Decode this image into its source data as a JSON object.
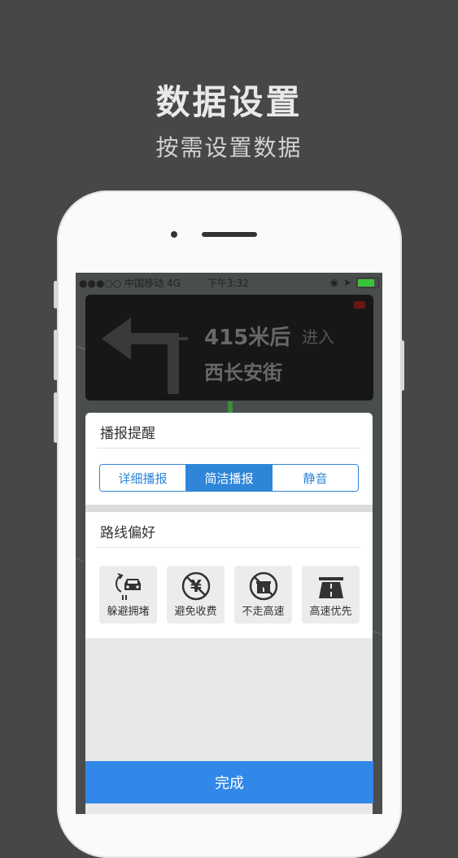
{
  "promo": {
    "title": "数据设置",
    "subtitle": "按需设置数据"
  },
  "statusbar": {
    "carrier": "●●●○○ 中国移动  4G",
    "time": "下午3:32",
    "battery_color": "#39c339"
  },
  "nav": {
    "distance": "415米后",
    "action": "进入",
    "street": "西长安街",
    "turn_icon": "turn-left-arrow"
  },
  "broadcast": {
    "title": "播报提醒",
    "options": [
      "详细播报",
      "简洁播报",
      "静音"
    ],
    "selected": "简洁播报"
  },
  "route": {
    "title": "路线偏好",
    "options": [
      {
        "label": "躲避拥堵",
        "icon": "avoid-congestion-icon"
      },
      {
        "label": "避免收费",
        "icon": "no-toll-icon"
      },
      {
        "label": "不走高速",
        "icon": "no-highway-icon"
      },
      {
        "label": "高速优先",
        "icon": "highway-first-icon"
      }
    ]
  },
  "done_label": "完成",
  "colors": {
    "accent": "#2f86d8",
    "done_button": "#3188e8",
    "background": "#474747"
  }
}
